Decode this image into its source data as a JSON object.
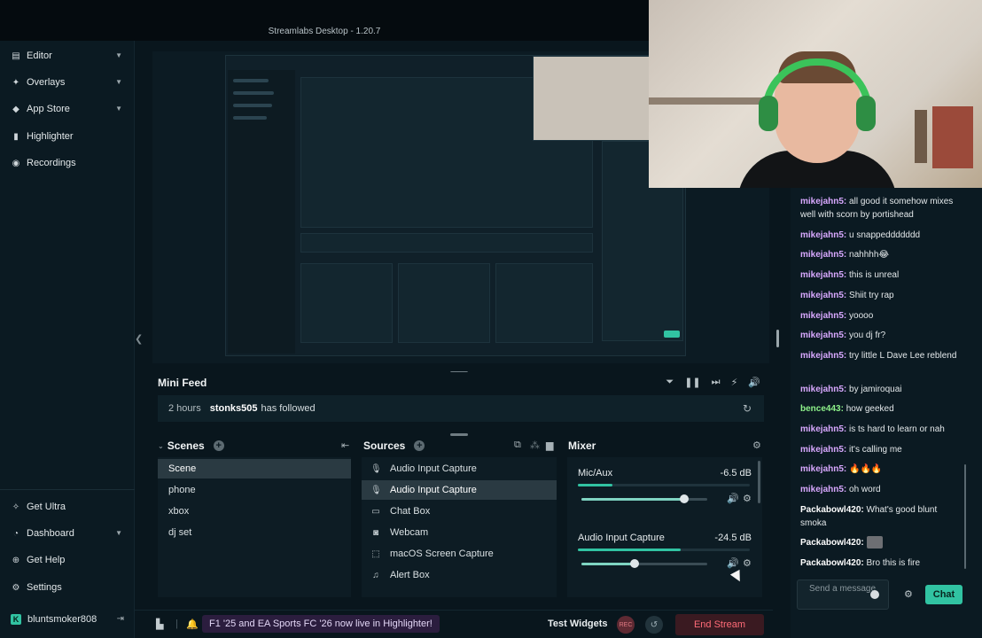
{
  "window": {
    "title": "Streamlabs Desktop - 1.20.7"
  },
  "sidebar": {
    "items": [
      {
        "label": "Editor",
        "icon": "editor-icon"
      },
      {
        "label": "Overlays",
        "icon": "overlays-icon"
      },
      {
        "label": "App Store",
        "icon": "app-store-icon"
      },
      {
        "label": "Highlighter",
        "icon": "highlighter-icon"
      },
      {
        "label": "Recordings",
        "icon": "recordings-icon"
      }
    ],
    "bottom": [
      {
        "label": "Get Ultra",
        "icon": "ultra-icon"
      },
      {
        "label": "Dashboard",
        "icon": "dashboard-icon"
      },
      {
        "label": "Get Help",
        "icon": "help-icon"
      },
      {
        "label": "Settings",
        "icon": "gear-icon"
      }
    ],
    "user": "bluntsmoker808"
  },
  "minifeed": {
    "title": "Mini Feed",
    "event": {
      "time": "2 hours",
      "user": "stonks505",
      "action": "has followed"
    }
  },
  "scenes": {
    "title": "Scenes",
    "items": [
      "Scene",
      "phone",
      "xbox",
      "dj set"
    ]
  },
  "sources": {
    "title": "Sources",
    "items": [
      {
        "label": "Audio Input Capture",
        "icon": "mic-icon"
      },
      {
        "label": "Audio Input Capture",
        "icon": "mic-icon"
      },
      {
        "label": "Chat Box",
        "icon": "chat-icon"
      },
      {
        "label": "Webcam",
        "icon": "camera-icon"
      },
      {
        "label": "macOS Screen Capture",
        "icon": "screen-icon"
      },
      {
        "label": "Alert Box",
        "icon": "bell-icon"
      }
    ]
  },
  "mixer": {
    "title": "Mixer",
    "channels": [
      {
        "name": "Mic/Aux",
        "db": "-6.5 dB",
        "meter": 0.2,
        "volume": 0.82
      },
      {
        "name": "Audio Input Capture",
        "db": "-24.5 dB",
        "meter": 0.6,
        "volume": 0.42
      }
    ]
  },
  "footer": {
    "ticker": "F1 '25 and EA Sports FC '26 now live in Highlighter!",
    "test_widgets": "Test Widgets",
    "rec": "REC",
    "end_stream": "End Stream"
  },
  "chat": {
    "messages": [
      {
        "user": "mikejahn5:",
        "text": "all good it somehow mixes well with scorn by portishead",
        "style": "purple"
      },
      {
        "user": "mikejahn5:",
        "text": "u snappeddddddd",
        "style": "purple"
      },
      {
        "user": "mikejahn5:",
        "text": "nahhhh😂",
        "style": "purple"
      },
      {
        "user": "mikejahn5:",
        "text": "this is unreal",
        "style": "purple"
      },
      {
        "user": "mikejahn5:",
        "text": "Shiit try rap",
        "style": "purple"
      },
      {
        "user": "mikejahn5:",
        "text": "yoooo",
        "style": "purple"
      },
      {
        "user": "mikejahn5:",
        "text": "you dj fr?",
        "style": "purple"
      },
      {
        "user": "mikejahn5:",
        "text": "try little L Dave Lee reblend",
        "style": "purple"
      },
      {
        "user": "mikejahn5:",
        "text": "by jamiroquai",
        "style": "purple"
      },
      {
        "user": "bence443:",
        "text": "how geeked",
        "style": "green"
      },
      {
        "user": "mikejahn5:",
        "text": "is ts hard to learn or nah",
        "style": "purple"
      },
      {
        "user": "mikejahn5:",
        "text": "it's calling me",
        "style": "purple"
      },
      {
        "user": "mikejahn5:",
        "text": "🔥🔥🔥",
        "style": "purple"
      },
      {
        "user": "mikejahn5:",
        "text": "oh word",
        "style": "purple"
      },
      {
        "user": "Packabowl420:",
        "text": "What's good blunt smoka",
        "style": "white"
      },
      {
        "user": "Packabowl420:",
        "text": "",
        "style": "white"
      },
      {
        "user": "Packabowl420:",
        "text": "Bro this is fire",
        "style": "white"
      }
    ],
    "input_placeholder": "Send a message",
    "send_label": "Chat"
  },
  "colors": {
    "accent": "#31c3a2",
    "end_stream": "#ff6b77",
    "chat_user": "#d8a8ff",
    "chat_user_alt": "#8ef28a"
  }
}
